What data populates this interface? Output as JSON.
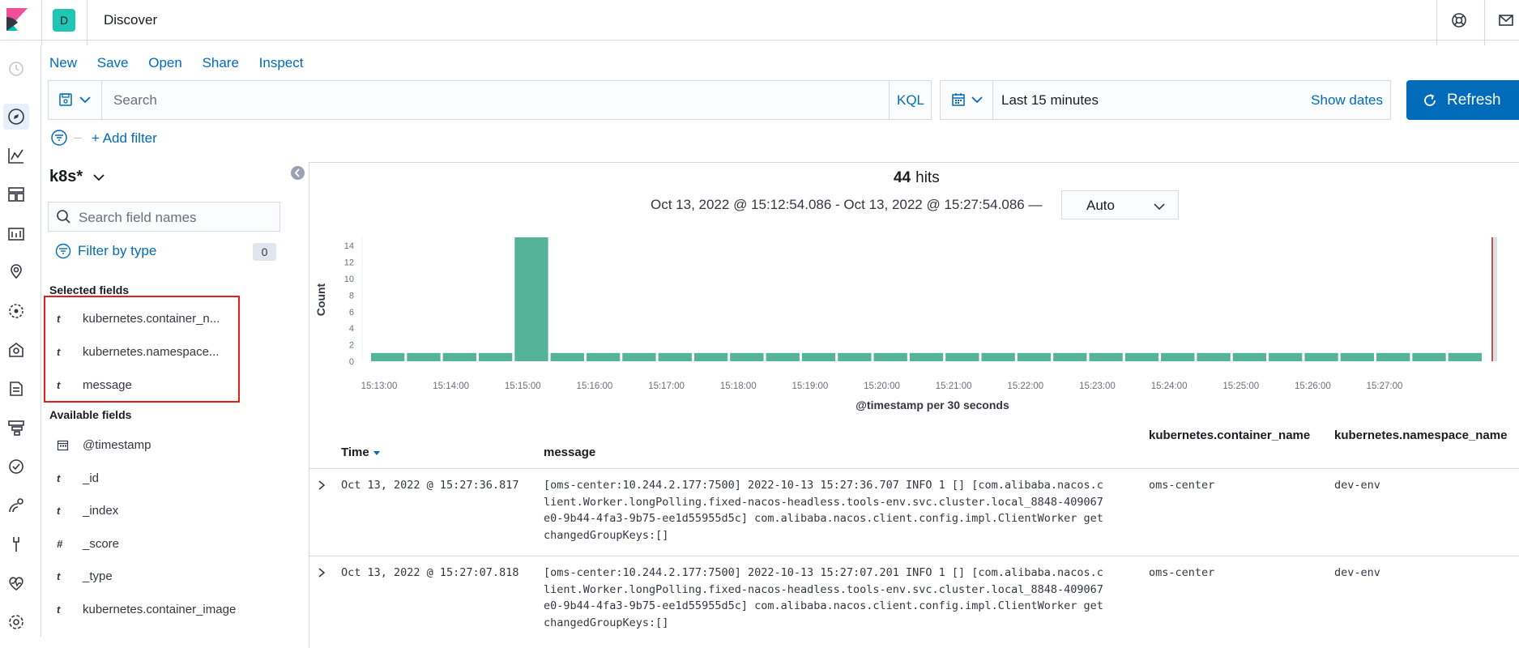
{
  "header": {
    "space_initial": "D",
    "app_title": "Discover"
  },
  "topmenu": [
    "New",
    "Save",
    "Open",
    "Share",
    "Inspect"
  ],
  "query": {
    "placeholder": "Search",
    "language": "KQL"
  },
  "timepicker": {
    "range": "Last 15 minutes",
    "show_dates": "Show dates"
  },
  "refresh_label": "Refresh",
  "filter": {
    "add_label": "+ Add filter"
  },
  "sidebar": {
    "index_pattern": "k8s*",
    "search_placeholder": "Search field names",
    "filter_by_type": "Filter by type",
    "filter_count": "0",
    "selected_title": "Selected fields",
    "selected": [
      {
        "type": "t",
        "name": "kubernetes.container_n..."
      },
      {
        "type": "t",
        "name": "kubernetes.namespace..."
      },
      {
        "type": "t",
        "name": "message"
      }
    ],
    "available_title": "Available fields",
    "available": [
      {
        "type": "cal",
        "name": "@timestamp"
      },
      {
        "type": "t",
        "name": "_id"
      },
      {
        "type": "t",
        "name": "_index"
      },
      {
        "type": "#",
        "name": "_score"
      },
      {
        "type": "t",
        "name": "_type"
      },
      {
        "type": "t",
        "name": "kubernetes.container_image"
      }
    ]
  },
  "histogram": {
    "hits_count": "44",
    "hits_label": "hits",
    "range": "Oct 13, 2022 @ 15:12:54.086 - Oct 13, 2022 @ 15:27:54.086 —",
    "interval": "Auto"
  },
  "chart_data": {
    "type": "bar",
    "ylabel": "Count",
    "xlabel": "@timestamp per 30 seconds",
    "ylim": [
      0,
      15
    ],
    "yticks": [
      0,
      2,
      4,
      6,
      8,
      10,
      12,
      14
    ],
    "xticks": [
      "15:13:00",
      "15:14:00",
      "15:15:00",
      "15:16:00",
      "15:17:00",
      "15:18:00",
      "15:19:00",
      "15:20:00",
      "15:21:00",
      "15:22:00",
      "15:23:00",
      "15:24:00",
      "15:25:00",
      "15:26:00",
      "15:27:00"
    ],
    "values": [
      1,
      1,
      1,
      1,
      15,
      1,
      1,
      1,
      1,
      1,
      1,
      1,
      1,
      1,
      1,
      1,
      1,
      1,
      1,
      1,
      1,
      1,
      1,
      1,
      1,
      1,
      1,
      1,
      1,
      1,
      1
    ],
    "bar_color": "#54b399",
    "now_marker_color": "#bd271e"
  },
  "table": {
    "columns": [
      "Time",
      "message",
      "kubernetes.container_name",
      "kubernetes.namespace_name"
    ],
    "rows": [
      {
        "time": "Oct 13, 2022 @ 15:27:36.817",
        "message": [
          "[oms-center:10.244.2.177:7500] 2022-10-13 15:27:36.707 INFO 1 [] [com.alibaba.nacos.c",
          "lient.Worker.longPolling.fixed-nacos-headless.tools-env.svc.cluster.local_8848-409067",
          "e0-9b44-4fa3-9b75-ee1d55955d5c] com.alibaba.nacos.client.config.impl.ClientWorker get",
          "changedGroupKeys:[]"
        ],
        "container": "oms-center",
        "namespace": "dev-env"
      },
      {
        "time": "Oct 13, 2022 @ 15:27:07.818",
        "message": [
          "[oms-center:10.244.2.177:7500] 2022-10-13 15:27:07.201 INFO 1 [] [com.alibaba.nacos.c",
          "lient.Worker.longPolling.fixed-nacos-headless.tools-env.svc.cluster.local_8848-409067",
          "e0-9b44-4fa3-9b75-ee1d55955d5c] com.alibaba.nacos.client.config.impl.ClientWorker get",
          "changedGroupKeys:[]"
        ],
        "container": "oms-center",
        "namespace": "dev-env"
      }
    ]
  }
}
